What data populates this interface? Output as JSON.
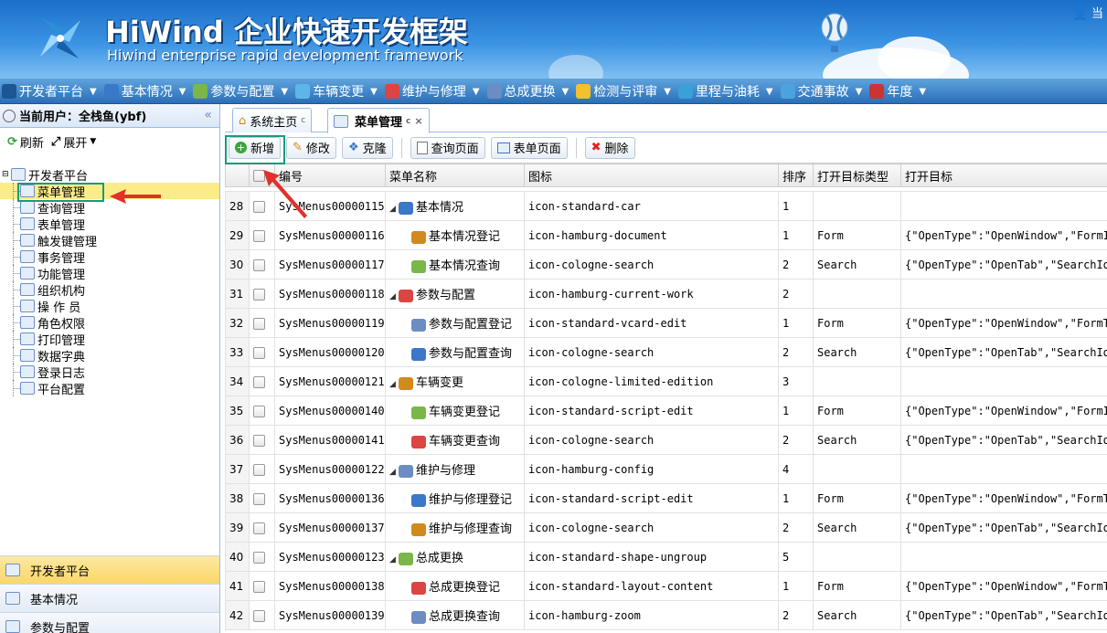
{
  "header": {
    "title": "HiWind 企业快速开发框架",
    "subtitle": "Hiwind enterprise rapid development framework",
    "user_partial": "当"
  },
  "menubar": [
    {
      "label": "开发者平台",
      "icon": "platform-icon",
      "color": "#1d5693"
    },
    {
      "label": "基本情况",
      "icon": "car-icon",
      "color": "#3a78c8"
    },
    {
      "label": "参数与配置",
      "icon": "current-work-icon",
      "color": "#7ab648"
    },
    {
      "label": "车辆变更",
      "icon": "limited-edition-icon",
      "color": "#5fb5e8"
    },
    {
      "label": "维护与修理",
      "icon": "config-icon",
      "color": "#d44"
    },
    {
      "label": "总成更换",
      "icon": "ungroup-icon",
      "color": "#6c8cc4"
    },
    {
      "label": "检测与评审",
      "icon": "star-icon",
      "color": "#f3c12b"
    },
    {
      "label": "里程与油耗",
      "icon": "boat-icon",
      "color": "#3aa0d8"
    },
    {
      "label": "交通事故",
      "icon": "accident-icon",
      "color": "#4aa3df"
    },
    {
      "label": "年度",
      "icon": "clock-icon",
      "color": "#c33"
    }
  ],
  "left": {
    "current_user": "当前用户：全栈鱼(ybf)",
    "refresh": "刷新",
    "expand": "展开",
    "tree_root": "开发者平台",
    "tree_items": [
      "菜单管理",
      "查询管理",
      "表单管理",
      "触发键管理",
      "事务管理",
      "功能管理",
      "组织机构",
      "操 作 员",
      "角色权限",
      "打印管理",
      "数据字典",
      "登录日志",
      "平台配置"
    ],
    "accordion": [
      "开发者平台",
      "基本情况",
      "参数与配置"
    ]
  },
  "tabs": [
    {
      "label": "系统主页"
    },
    {
      "label": "菜单管理"
    }
  ],
  "toolbar": {
    "add": "新增",
    "edit": "修改",
    "clone": "克隆",
    "query_page": "查询页面",
    "form_page": "表单页面",
    "delete": "删除"
  },
  "grid": {
    "headers": [
      "编号",
      "菜单名称",
      "图标",
      "排序",
      "打开目标类型",
      "打开目标"
    ],
    "rows": [
      {
        "rn": "28",
        "code": "SysMenus00000115",
        "name": "基本情况",
        "level": 0,
        "icon": "icon-standard-car",
        "sort": "1",
        "type": "",
        "target": ""
      },
      {
        "rn": "29",
        "code": "SysMenus00000116",
        "name": "基本情况登记",
        "level": 1,
        "icon": "icon-hamburg-document",
        "sort": "1",
        "type": "Form",
        "target": "{\"OpenType\":\"OpenWindow\",\"FormId"
      },
      {
        "rn": "30",
        "code": "SysMenus00000117",
        "name": "基本情况查询",
        "level": 1,
        "icon": "icon-cologne-search",
        "sort": "2",
        "type": "Search",
        "target": "{\"OpenType\":\"OpenTab\",\"SearchId\""
      },
      {
        "rn": "31",
        "code": "SysMenus00000118",
        "name": "参数与配置",
        "level": 0,
        "icon": "icon-hamburg-current-work",
        "sort": "2",
        "type": "",
        "target": ""
      },
      {
        "rn": "32",
        "code": "SysMenus00000119",
        "name": "参数与配置登记",
        "level": 1,
        "icon": "icon-standard-vcard-edit",
        "sort": "1",
        "type": "Form",
        "target": "{\"OpenType\":\"OpenWindow\",\"FormTy"
      },
      {
        "rn": "33",
        "code": "SysMenus00000120",
        "name": "参数与配置查询",
        "level": 1,
        "icon": "icon-cologne-search",
        "sort": "2",
        "type": "Search",
        "target": "{\"OpenType\":\"OpenTab\",\"SearchId\""
      },
      {
        "rn": "34",
        "code": "SysMenus00000121",
        "name": "车辆变更",
        "level": 0,
        "icon": "icon-cologne-limited-edition",
        "sort": "3",
        "type": "",
        "target": ""
      },
      {
        "rn": "35",
        "code": "SysMenus00000140",
        "name": "车辆变更登记",
        "level": 1,
        "icon": "icon-standard-script-edit",
        "sort": "1",
        "type": "Form",
        "target": "{\"OpenType\":\"OpenWindow\",\"FormId"
      },
      {
        "rn": "36",
        "code": "SysMenus00000141",
        "name": "车辆变更查询",
        "level": 1,
        "icon": "icon-cologne-search",
        "sort": "2",
        "type": "Search",
        "target": "{\"OpenType\":\"OpenTab\",\"SearchId\""
      },
      {
        "rn": "37",
        "code": "SysMenus00000122",
        "name": "维护与修理",
        "level": 0,
        "icon": "icon-hamburg-config",
        "sort": "4",
        "type": "",
        "target": ""
      },
      {
        "rn": "38",
        "code": "SysMenus00000136",
        "name": "维护与修理登记",
        "level": 1,
        "icon": "icon-standard-script-edit",
        "sort": "1",
        "type": "Form",
        "target": "{\"OpenType\":\"OpenWindow\",\"FormTy"
      },
      {
        "rn": "39",
        "code": "SysMenus00000137",
        "name": "维护与修理查询",
        "level": 1,
        "icon": "icon-cologne-search",
        "sort": "2",
        "type": "Search",
        "target": "{\"OpenType\":\"OpenTab\",\"SearchId\""
      },
      {
        "rn": "40",
        "code": "SysMenus00000123",
        "name": "总成更换",
        "level": 0,
        "icon": "icon-standard-shape-ungroup",
        "sort": "5",
        "type": "",
        "target": ""
      },
      {
        "rn": "41",
        "code": "SysMenus00000138",
        "name": "总成更换登记",
        "level": 1,
        "icon": "icon-standard-layout-content",
        "sort": "1",
        "type": "Form",
        "target": "{\"OpenType\":\"OpenWindow\",\"FormTy"
      },
      {
        "rn": "42",
        "code": "SysMenus00000139",
        "name": "总成更换查询",
        "level": 1,
        "icon": "icon-hamburg-zoom",
        "sort": "2",
        "type": "Search",
        "target": "{\"OpenType\":\"OpenTab\",\"SearchId\""
      }
    ]
  }
}
